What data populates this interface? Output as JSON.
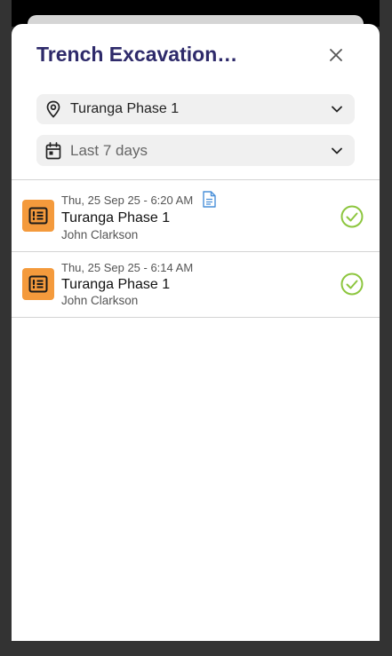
{
  "dialog": {
    "title": "Trench Excavation…"
  },
  "filters": {
    "site": {
      "label": "Turanga Phase 1",
      "icon": "location-pin-icon"
    },
    "period": {
      "label": "Last 7 days",
      "icon": "calendar-icon"
    }
  },
  "entries": [
    {
      "timestamp": "Thu, 25 Sep 25 - 6:20 AM",
      "site": "Turanga Phase 1",
      "person": "John Clarkson",
      "has_document": true,
      "status": "complete"
    },
    {
      "timestamp": "Thu, 25 Sep 25 - 6:14 AM",
      "site": "Turanga Phase 1",
      "person": "John Clarkson",
      "has_document": false,
      "status": "complete"
    }
  ],
  "colors": {
    "title": "#2e2a6a",
    "badge": "#f49a3c",
    "check": "#8dc63f",
    "document": "#4a90d9",
    "filter_bg": "#f0f0f0"
  }
}
